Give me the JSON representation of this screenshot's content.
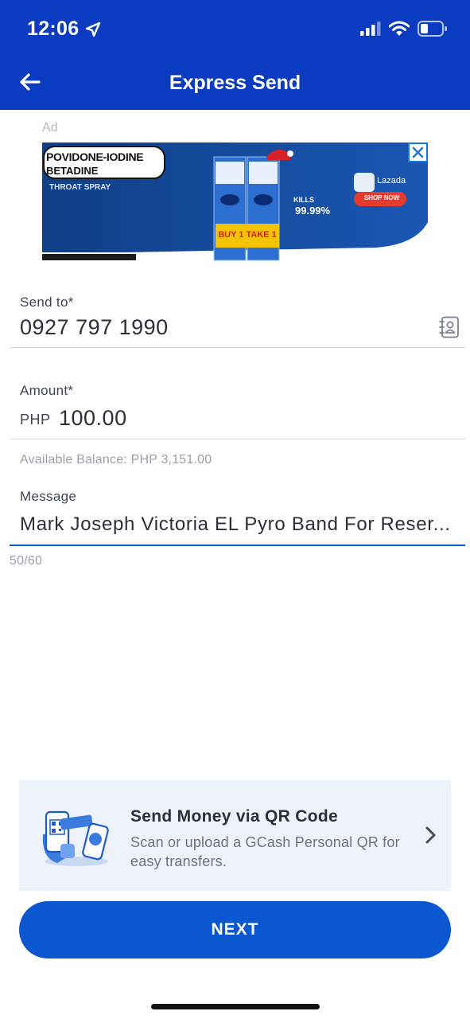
{
  "status_bar": {
    "time": "12:06"
  },
  "header": {
    "title": "Express Send"
  },
  "ad": {
    "label": "Ad",
    "brand_line1": "POVIDONE-IODINE",
    "brand_line2": "BETADINE",
    "product_type": "THROAT SPRAY",
    "promo": "BUY 1 TAKE 1",
    "kills_text": "KILLS",
    "kills_value": "99.99%",
    "store": "Lazada",
    "cta": "SHOP NOW"
  },
  "form": {
    "send_to": {
      "label": "Send to*",
      "value": "0927 797 1990"
    },
    "amount": {
      "label": "Amount*",
      "currency": "PHP",
      "value": "100.00"
    },
    "balance": "Available Balance: PHP 3,151.00",
    "message": {
      "label": "Message",
      "value": "Mark Joseph Victoria EL Pyro Band  For Reser...",
      "counter": "50/60"
    }
  },
  "qr_card": {
    "title": "Send Money via QR Code",
    "description": "Scan or upload a GCash Personal QR for easy transfers."
  },
  "next_button": {
    "label": "NEXT"
  },
  "colors": {
    "primary": "#0b57d0",
    "header": "#0a3bc0",
    "card_bg": "#eef2fa"
  }
}
